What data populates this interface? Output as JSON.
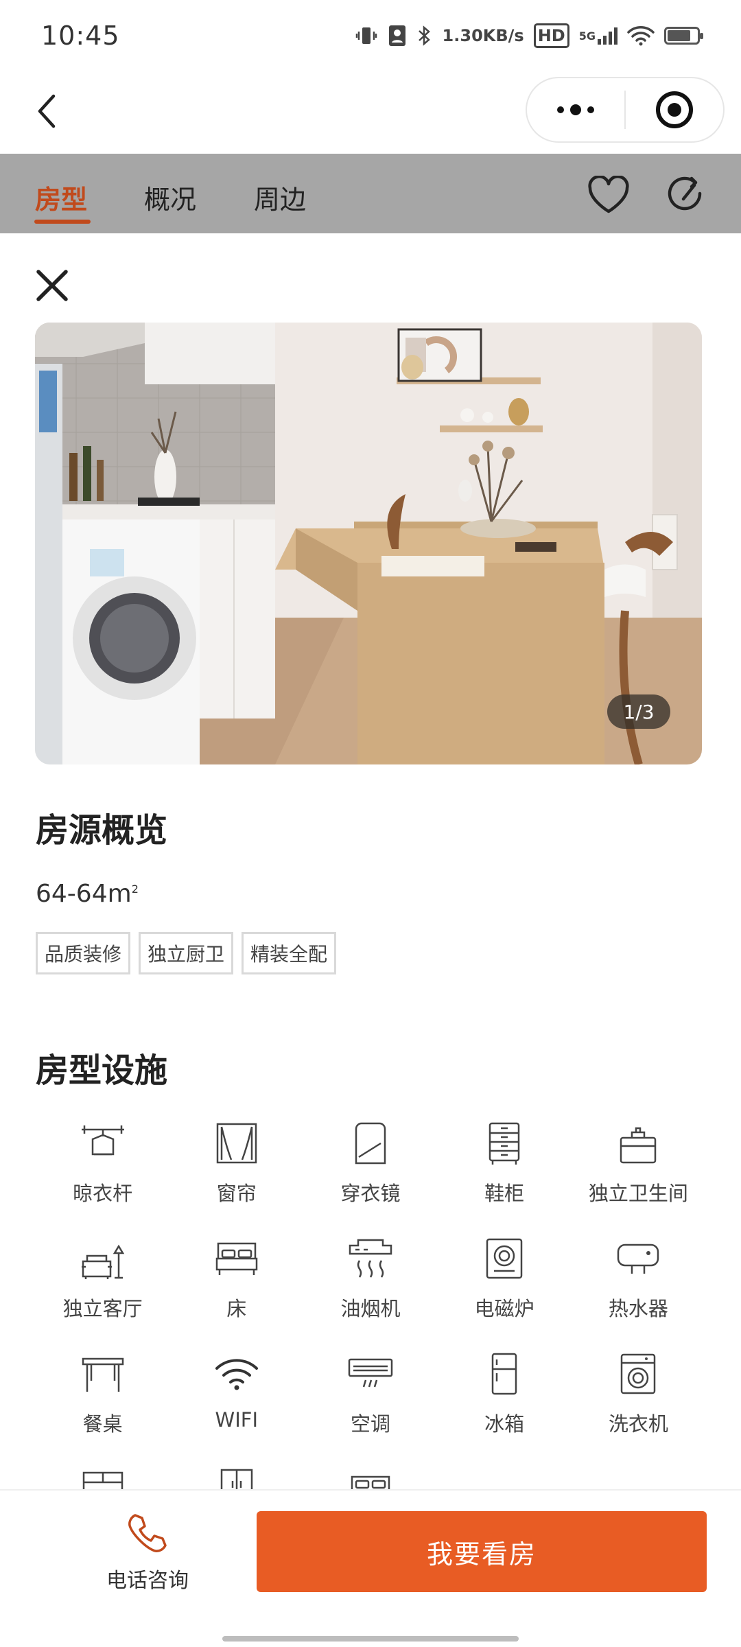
{
  "status_bar": {
    "time": "10:45",
    "net_speed_value": "1.30",
    "net_speed_unit": "KB/s",
    "hd_label": "HD",
    "signal_label": "5G",
    "battery_level": 0.75
  },
  "tabs": [
    {
      "label": "房型",
      "active": true
    },
    {
      "label": "概况",
      "active": false
    },
    {
      "label": "周边",
      "active": false
    }
  ],
  "photo": {
    "counter": "1/3"
  },
  "overview": {
    "title": "房源概览",
    "area_text": "64-64m",
    "area_unit_sup": "2",
    "tags": [
      "品质装修",
      "独立厨卫",
      "精装全配"
    ]
  },
  "facilities": {
    "title": "房型设施",
    "items": [
      {
        "label": "晾衣杆",
        "icon": "clothes-rack-icon"
      },
      {
        "label": "窗帘",
        "icon": "curtain-icon"
      },
      {
        "label": "穿衣镜",
        "icon": "mirror-icon"
      },
      {
        "label": "鞋柜",
        "icon": "shoe-cabinet-icon"
      },
      {
        "label": "独立卫生间",
        "icon": "toilet-icon"
      },
      {
        "label": "独立客厅",
        "icon": "living-room-icon"
      },
      {
        "label": "床",
        "icon": "bed-icon"
      },
      {
        "label": "油烟机",
        "icon": "range-hood-icon"
      },
      {
        "label": "电磁炉",
        "icon": "induction-cooker-icon"
      },
      {
        "label": "热水器",
        "icon": "water-heater-icon"
      },
      {
        "label": "餐桌",
        "icon": "dining-table-icon"
      },
      {
        "label": "WIFI",
        "icon": "wifi-icon"
      },
      {
        "label": "空调",
        "icon": "air-conditioner-icon"
      },
      {
        "label": "冰箱",
        "icon": "fridge-icon"
      },
      {
        "label": "洗衣机",
        "icon": "washing-machine-icon"
      }
    ]
  },
  "bottom_bar": {
    "phone_label": "电话咨询",
    "cta_label": "我要看房"
  },
  "colors": {
    "accent": "#c14a1c",
    "cta": "#e85c24"
  }
}
